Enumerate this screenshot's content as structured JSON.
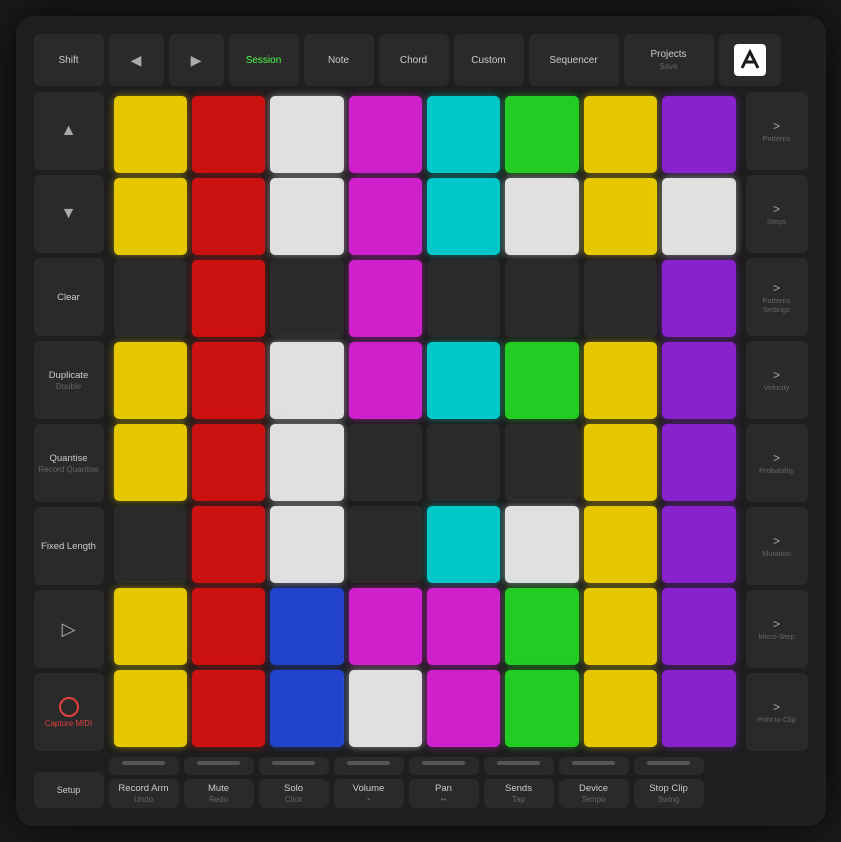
{
  "top": {
    "shift": "Shift",
    "back": "◀",
    "forward": "▶",
    "session": "Session",
    "note": "Note",
    "chord": "Chord",
    "custom": "Custom",
    "sequencer": "Sequencer",
    "projects": "Projects",
    "projects_sub": "Save"
  },
  "left": [
    {
      "main": "▲",
      "sub": ""
    },
    {
      "main": "▼",
      "sub": ""
    },
    {
      "main": "Clear",
      "sub": ""
    },
    {
      "main": "Duplicate",
      "sub": "Double"
    },
    {
      "main": "Quantise",
      "sub": "Record Quantise"
    },
    {
      "main": "Fixed Length",
      "sub": ""
    },
    {
      "main": "▷",
      "sub": ""
    },
    {
      "main": "○",
      "sub": "Capture MIDI",
      "red": true
    }
  ],
  "right": [
    {
      "main": ">",
      "sub": "Patterns"
    },
    {
      "main": ">",
      "sub": "Steps"
    },
    {
      "main": ">",
      "sub": "Patterns Settings"
    },
    {
      "main": ">",
      "sub": "Velocity"
    },
    {
      "main": ">",
      "sub": "Probability"
    },
    {
      "main": ">",
      "sub": "Mutation"
    },
    {
      "main": ">",
      "sub": "Micro-Step"
    },
    {
      "main": ">",
      "sub": "Print to Clip"
    }
  ],
  "bottom": [
    {
      "strip": true,
      "main": "Record Arm",
      "sub": "Undo"
    },
    {
      "strip": true,
      "main": "Mute",
      "sub": "Redo"
    },
    {
      "strip": true,
      "main": "Solo",
      "sub": "Click"
    },
    {
      "strip": true,
      "main": "Volume",
      "sub": "•"
    },
    {
      "strip": true,
      "main": "Pan",
      "sub": "••"
    },
    {
      "strip": true,
      "main": "Sends",
      "sub": "Tap"
    },
    {
      "strip": true,
      "main": "Device",
      "sub": "Tempo"
    },
    {
      "strip": true,
      "main": "Stop Clip",
      "sub": "Swing"
    }
  ],
  "setup": "Setup",
  "pads": [
    [
      "yellow",
      "red",
      "white",
      "magenta",
      "cyan",
      "green",
      "yellow",
      "purple"
    ],
    [
      "yellow",
      "red",
      "white",
      "magenta",
      "cyan",
      "white",
      "yellow",
      "white"
    ],
    [
      "dark",
      "red",
      "dark",
      "magenta",
      "dark",
      "dark",
      "dark",
      "purple"
    ],
    [
      "yellow",
      "red",
      "white",
      "magenta",
      "cyan",
      "green",
      "yellow",
      "purple"
    ],
    [
      "yellow",
      "red",
      "white",
      "dark",
      "dark",
      "dark",
      "yellow",
      "purple"
    ],
    [
      "dark",
      "red",
      "white",
      "dark",
      "cyan",
      "white",
      "yellow",
      "purple"
    ],
    [
      "yellow",
      "red",
      "blue",
      "white",
      "magenta",
      "green",
      "yellow",
      "purple"
    ],
    [
      "yellow",
      "red",
      "blue",
      "white",
      "magenta",
      "green",
      "yellow",
      "purple"
    ]
  ]
}
